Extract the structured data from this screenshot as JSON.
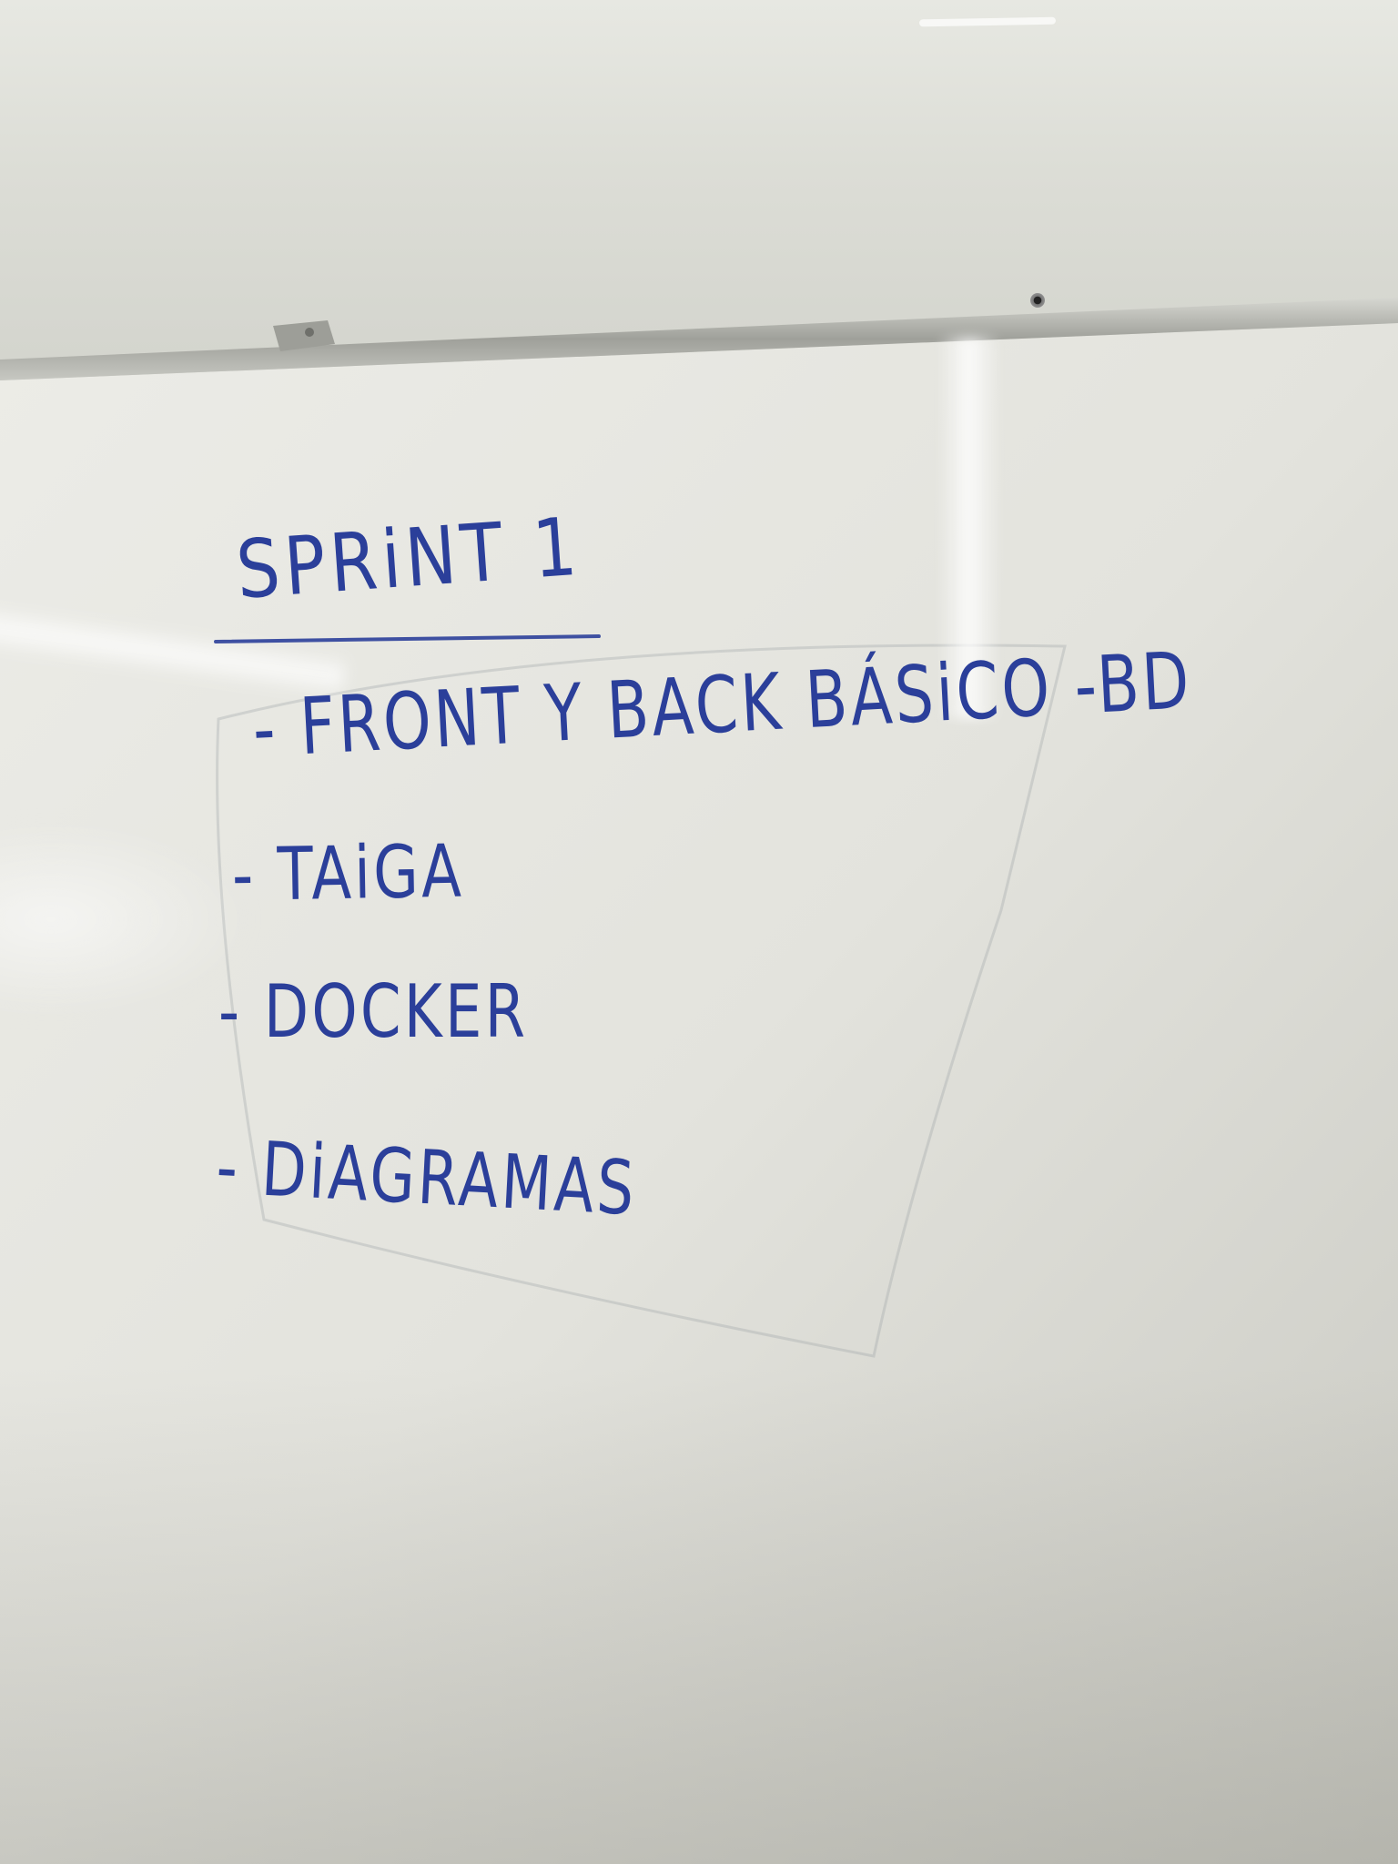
{
  "whiteboard": {
    "title": "SPRiNT 1",
    "items": [
      "- FRONT Y BACK BÁSiCO -BD",
      "- TAiGA",
      "- DOCKER",
      "- DiAGRAMAS"
    ]
  },
  "colors": {
    "ink": "#2b3f9a",
    "board": "#e9e9e3",
    "wall": "#dcddd6",
    "frame": "#a7a8a2"
  }
}
